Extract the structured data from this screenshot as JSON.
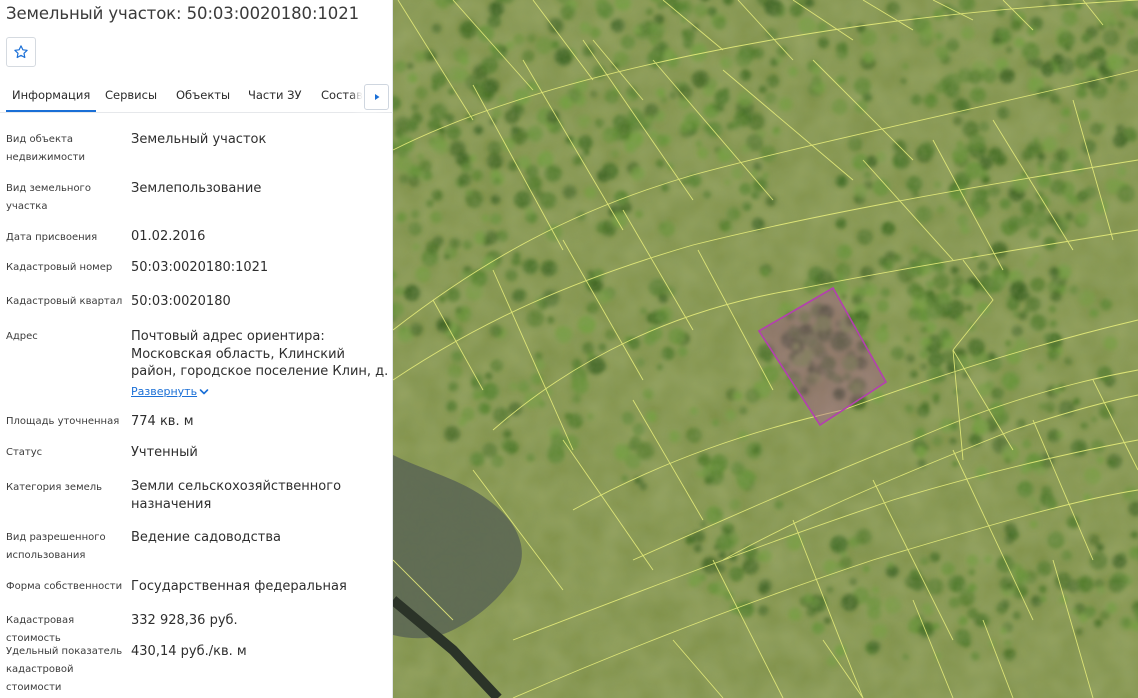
{
  "header": {
    "title": "Земельный участок: 50:03:0020180:1021",
    "favorite_icon": "star-outline-icon"
  },
  "tabs": [
    {
      "label": "Информация",
      "active": true
    },
    {
      "label": "Сервисы",
      "active": false
    },
    {
      "label": "Объекты",
      "active": false
    },
    {
      "label": "Части ЗУ",
      "active": false
    },
    {
      "label": "Состав ЕЗП",
      "active": false
    }
  ],
  "tabs_next_icon": "triangle-right-icon",
  "info": {
    "object_type": {
      "label_1": "Вид объекта",
      "label_2": "недвижимости",
      "value": "Земельный участок"
    },
    "land_kind": {
      "label_1": "Вид земельного",
      "label_2": "участка",
      "value": "Землепользование"
    },
    "assigned_date": {
      "label": "Дата присвоения",
      "value": "01.02.2016"
    },
    "cadastral_number": {
      "label": "Кадастровый номер",
      "value": "50:03:0020180:1021"
    },
    "cadastral_quarter": {
      "label": "Кадастровый квартал",
      "value": "50:03:0020180"
    },
    "address": {
      "label": "Адрес",
      "line_1": "Почтовый адрес ориентира:",
      "line_2": "Московская область, Клинский",
      "line_3": "район, городское поселение Клин, д.",
      "expand_label": "Развернуть"
    },
    "area": {
      "label": "Площадь уточненная",
      "value": "774 кв. м"
    },
    "status": {
      "label": "Статус",
      "value": "Учтенный"
    },
    "land_category": {
      "label": "Категория земель",
      "value_1": "Земли сельскохозяйственного",
      "value_2": "назначения"
    },
    "permitted_use": {
      "label_1": "Вид разрешенного",
      "label_2": "использования",
      "value": "Ведение садоводства"
    },
    "ownership": {
      "label": "Форма собственности",
      "value": "Государственная федеральная"
    },
    "cadastral_value": {
      "label": "Кадастровая стоимость",
      "value": "332 928,36 руб."
    },
    "specific_value": {
      "label_1": "Удельный показатель",
      "label_2": "кадастровой стоимости",
      "value": "430,14 руб./кв. м"
    }
  },
  "map": {
    "parcel_line_color": "#e6ec7a",
    "selected_parcel_color": "#b43fb0",
    "ground_color": "#7e8f45"
  }
}
